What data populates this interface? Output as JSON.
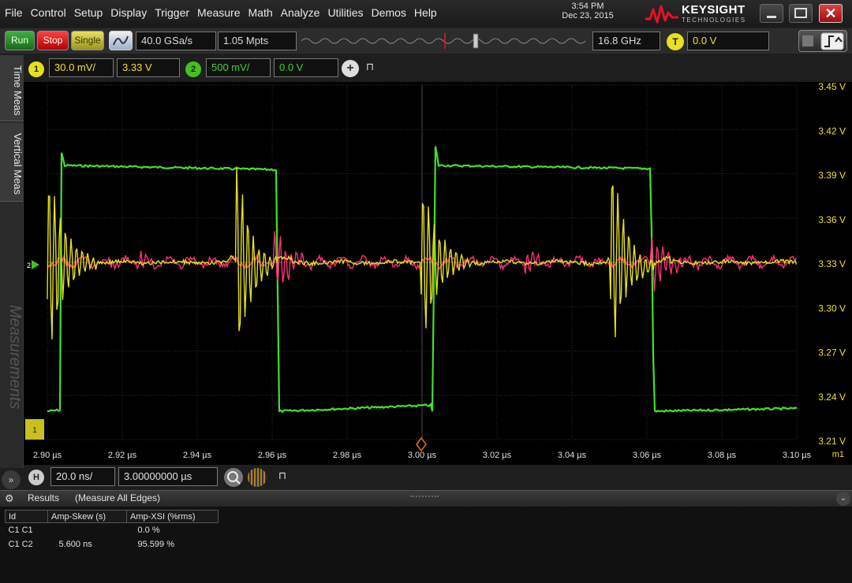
{
  "menu": [
    "File",
    "Control",
    "Setup",
    "Display",
    "Trigger",
    "Measure",
    "Math",
    "Analyze",
    "Utilities",
    "Demos",
    "Help"
  ],
  "clock": {
    "time": "3:54 PM",
    "date": "Dec 23, 2015"
  },
  "brand": {
    "name": "KEYSIGHT",
    "sub": "TECHNOLOGIES"
  },
  "window_buttons": {
    "close": "✕"
  },
  "toolbar": {
    "run": "Run",
    "stop": "Stop",
    "single": "Single",
    "sample_rate": "40.0 GSa/s",
    "memory_depth": "1.05 Mpts",
    "bandwidth": "16.8 GHz",
    "trigger_badge": "T",
    "trigger_level": "0.0 V"
  },
  "channels": {
    "ch1": {
      "badge": "1",
      "scale": "30.0 mV/",
      "offset": "3.33 V",
      "color": "#e6df1e"
    },
    "ch2": {
      "badge": "2",
      "scale": "500 mV/",
      "offset": "0.0 V",
      "color": "#44d020"
    },
    "math": {
      "color": "#ff2f7a"
    }
  },
  "side_tabs": {
    "time": "Time Meas",
    "vertical": "Vertical Meas",
    "measurements": "Measurements"
  },
  "plot": {
    "y_ticks": [
      "3.45 V",
      "3.42 V",
      "3.39 V",
      "3.36 V",
      "3.33 V",
      "3.30 V",
      "3.27 V",
      "3.24 V",
      "3.21 V"
    ],
    "x_ticks": [
      "2.90 µs",
      "2.92 µs",
      "2.94 µs",
      "2.96 µs",
      "2.98 µs",
      "3.00 µs",
      "3.02 µs",
      "3.04 µs",
      "3.06 µs",
      "3.08 µs",
      "3.10 µs"
    ],
    "marker_label": "m1",
    "ch_marker": "2",
    "trig_marker": "1"
  },
  "horizontal": {
    "badge": "H",
    "timebase": "20.0 ns/",
    "position": "3.00000000 µs"
  },
  "results": {
    "title": "Results",
    "subtitle": "(Measure All Edges)",
    "columns": [
      "Id",
      "Amp-Skew (s)",
      "Amp-XSI (%rms)"
    ],
    "rows": [
      {
        "id": "C1 C1",
        "skew": "",
        "xsi": "0.0 %"
      },
      {
        "id": "C1 C2",
        "skew": "5.600 ns",
        "xsi": "95.599 %"
      }
    ]
  }
}
